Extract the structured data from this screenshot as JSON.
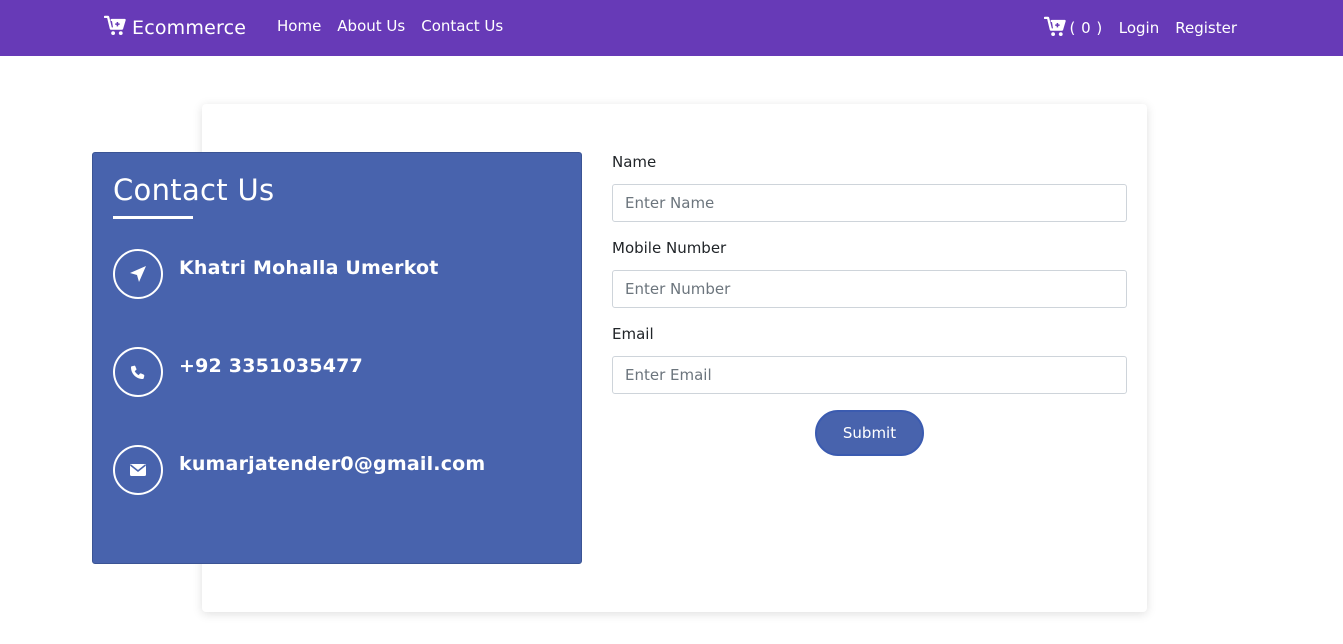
{
  "navbar": {
    "brand": "Ecommerce",
    "brand_icon": "cart-icon",
    "links": [
      "Home",
      "About Us",
      "Contact Us"
    ],
    "cart_count": "( 0 )",
    "login": "Login",
    "register": "Register",
    "bg_color": "#673ab7"
  },
  "contact": {
    "title": "Contact Us",
    "address": "Khatri Mohalla Umerkot",
    "phone": "+92 3351035477",
    "email": "kumarjatender0@gmail.com",
    "icons": [
      "location-arrow-icon",
      "phone-icon",
      "envelope-icon"
    ],
    "panel_color": "#4863ad"
  },
  "form": {
    "name_label": "Name",
    "name_placeholder": "Enter Name",
    "name_value": "",
    "mobile_label": "Mobile Number",
    "mobile_placeholder": "Enter Number",
    "mobile_value": "",
    "email_label": "Email",
    "email_placeholder": "Enter Email",
    "email_value": "",
    "submit_label": "Submit"
  }
}
